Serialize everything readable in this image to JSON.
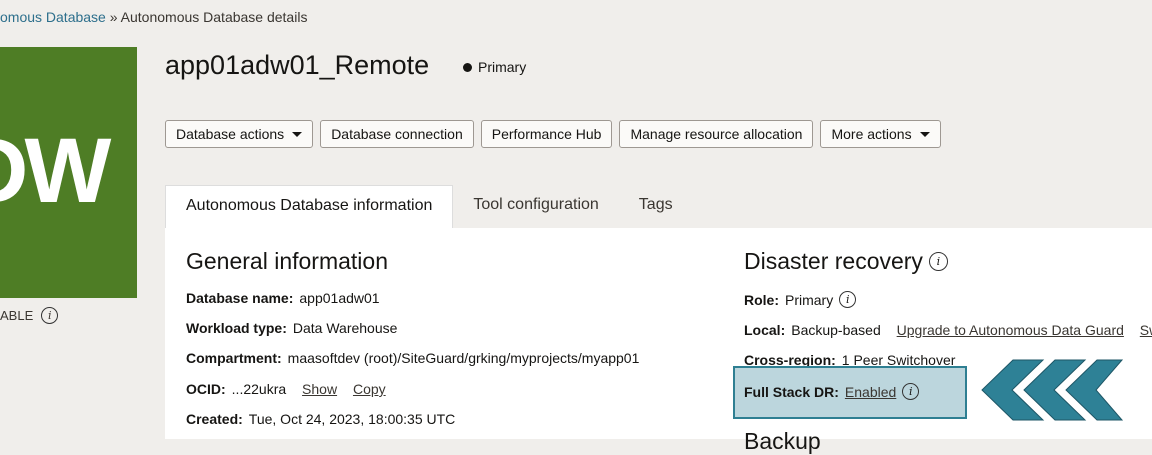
{
  "breadcrumb": {
    "parent": "omous Database",
    "separator": "»",
    "current": "Autonomous Database details"
  },
  "tile": {
    "text": "DW",
    "status_text": "ABLE"
  },
  "header": {
    "title": "app01adw01_Remote",
    "status": "Primary"
  },
  "actions": [
    "Database actions",
    "Database connection",
    "Performance Hub",
    "Manage resource allocation",
    "More actions"
  ],
  "tabs": [
    "Autonomous Database information",
    "Tool configuration",
    "Tags"
  ],
  "general": {
    "heading": "General information",
    "db_name_label": "Database name:",
    "db_name": "app01adw01",
    "workload_label": "Workload type:",
    "workload": "Data Warehouse",
    "compartment_label": "Compartment:",
    "compartment": "maasoftdev (root)/SiteGuard/grking/myprojects/myapp01",
    "ocid_label": "OCID:",
    "ocid": "...22ukra",
    "show": "Show",
    "copy": "Copy",
    "created_label": "Created:",
    "created": "Tue, Oct 24, 2023, 18:00:35 UTC"
  },
  "dr": {
    "heading": "Disaster recovery",
    "role_label": "Role:",
    "role": "Primary",
    "local_label": "Local:",
    "local": "Backup-based",
    "upgrade_link": "Upgrade to Autonomous Data Guard",
    "switch_link": "Swit",
    "cross_label": "Cross-region:",
    "cross": "1 Peer Switchover",
    "fsdr_label": "Full Stack DR:",
    "fsdr": "Enabled"
  },
  "backup_heading": "Backup",
  "colors": {
    "tile": "#4e7d25",
    "highlight": "#bcd6dd",
    "chevron": "#2e8196"
  }
}
